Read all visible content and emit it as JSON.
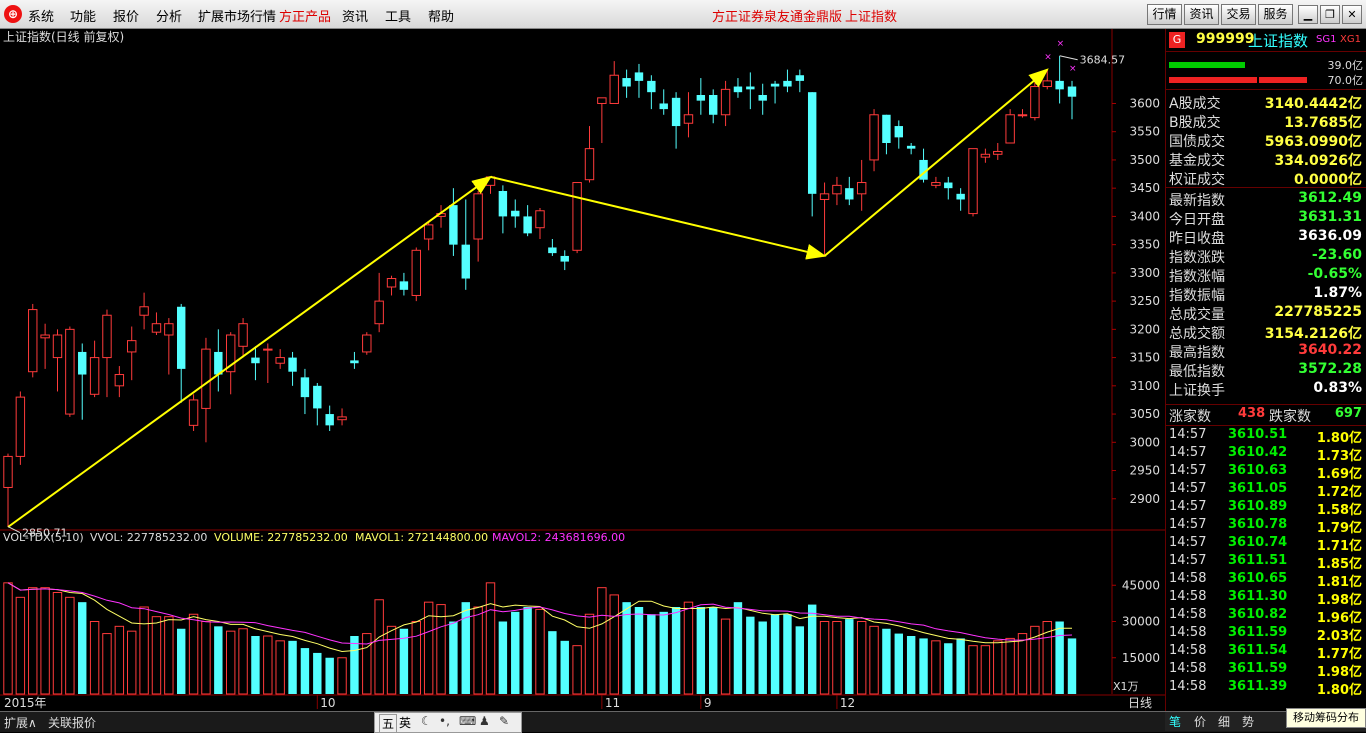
{
  "menubar": {
    "items": [
      "系统",
      "功能",
      "报价",
      "分析",
      "扩展市场行情",
      "方正产品",
      "资讯",
      "工具",
      "帮助"
    ],
    "red_item_index": 5,
    "center_title": "方正证券泉友通金鼎版",
    "center_index_title": "上证指数",
    "right_buttons": [
      "行情",
      "资讯",
      "交易",
      "服务"
    ]
  },
  "chart": {
    "title": "上证指数(日线 前复权)",
    "price_ticks": [
      "3600",
      "3550",
      "3500",
      "3450",
      "3400",
      "3350",
      "3300",
      "3250",
      "3200",
      "3150",
      "3100",
      "3050",
      "3000",
      "2950",
      "2900"
    ],
    "high_label": "3684.57",
    "low_label": "2850.71",
    "vol_legend": {
      "name": "VOL-TDX(5,10)",
      "vvol": "VVOL: 227785232.00",
      "volume": "VOLUME: 227785232.00",
      "mavol1": "MAVOL1: 272144800.00",
      "mavol2": "MAVOL2: 243681696.00"
    },
    "vol_ticks": [
      "45000",
      "30000",
      "15000"
    ],
    "vol_unit": "X1万",
    "x_labels": [
      "2015年",
      "9",
      "10",
      "11",
      "12"
    ],
    "period": "日线",
    "colors": {
      "up": "#ff3b3b",
      "down": "#54ffff",
      "mavol1": "#ffff66",
      "mavol2": "#ff33ff",
      "trend": "#ffff00"
    }
  },
  "chart_data": {
    "type": "candlestick",
    "candles": [
      [
        2920,
        2975,
        2850,
        2980
      ],
      [
        2975,
        3080,
        2960,
        3090
      ],
      [
        3125,
        3235,
        3115,
        3245
      ],
      [
        3185,
        3190,
        3130,
        3210
      ],
      [
        3150,
        3190,
        3090,
        3200
      ],
      [
        3050,
        3200,
        3045,
        3205
      ],
      [
        3160,
        3120,
        3040,
        3175
      ],
      [
        3085,
        3150,
        3080,
        3180
      ],
      [
        3150,
        3225,
        3080,
        3235
      ],
      [
        3100,
        3120,
        3080,
        3135
      ],
      [
        3160,
        3180,
        3110,
        3205
      ],
      [
        3225,
        3240,
        3200,
        3265
      ],
      [
        3195,
        3210,
        3190,
        3230
      ],
      [
        3190,
        3210,
        3120,
        3220
      ],
      [
        3240,
        3130,
        3070,
        3245
      ],
      [
        3030,
        3075,
        3020,
        3085
      ],
      [
        3060,
        3165,
        3000,
        3185
      ],
      [
        3160,
        3120,
        3090,
        3200
      ],
      [
        3125,
        3190,
        3085,
        3195
      ],
      [
        3170,
        3210,
        3150,
        3220
      ],
      [
        3150,
        3140,
        3110,
        3170
      ],
      [
        3165,
        3165,
        3105,
        3175
      ],
      [
        3140,
        3150,
        3130,
        3165
      ],
      [
        3150,
        3125,
        3100,
        3160
      ],
      [
        3115,
        3080,
        3050,
        3130
      ],
      [
        3100,
        3060,
        3030,
        3105
      ],
      [
        3050,
        3030,
        3020,
        3065
      ],
      [
        3040,
        3045,
        3030,
        3060
      ],
      [
        3145,
        3140,
        3130,
        3160
      ],
      [
        3160,
        3190,
        3155,
        3195
      ],
      [
        3210,
        3250,
        3195,
        3300
      ],
      [
        3275,
        3290,
        3260,
        3295
      ],
      [
        3285,
        3270,
        3260,
        3300
      ],
      [
        3260,
        3340,
        3250,
        3345
      ],
      [
        3360,
        3385,
        3340,
        3390
      ],
      [
        3400,
        3405,
        3380,
        3420
      ],
      [
        3420,
        3350,
        3330,
        3450
      ],
      [
        3350,
        3290,
        3270,
        3430
      ],
      [
        3360,
        3440,
        3320,
        3445
      ],
      [
        3455,
        3470,
        3440,
        3470
      ],
      [
        3445,
        3400,
        3370,
        3455
      ],
      [
        3410,
        3400,
        3380,
        3430
      ],
      [
        3400,
        3370,
        3365,
        3420
      ],
      [
        3380,
        3410,
        3360,
        3415
      ],
      [
        3345,
        3335,
        3330,
        3360
      ],
      [
        3330,
        3320,
        3305,
        3340
      ],
      [
        3340,
        3460,
        3335,
        3460
      ],
      [
        3465,
        3520,
        3460,
        3560
      ],
      [
        3600,
        3610,
        3530,
        3610
      ],
      [
        3600,
        3650,
        3600,
        3675
      ],
      [
        3645,
        3630,
        3610,
        3660
      ],
      [
        3655,
        3640,
        3610,
        3670
      ],
      [
        3640,
        3620,
        3590,
        3650
      ],
      [
        3600,
        3590,
        3580,
        3625
      ],
      [
        3610,
        3560,
        3520,
        3620
      ],
      [
        3565,
        3580,
        3540,
        3620
      ],
      [
        3615,
        3605,
        3580,
        3645
      ],
      [
        3615,
        3580,
        3565,
        3625
      ],
      [
        3580,
        3625,
        3560,
        3640
      ],
      [
        3630,
        3620,
        3610,
        3645
      ],
      [
        3630,
        3625,
        3590,
        3655
      ],
      [
        3615,
        3605,
        3580,
        3635
      ],
      [
        3635,
        3630,
        3600,
        3640
      ],
      [
        3640,
        3630,
        3620,
        3660
      ],
      [
        3650,
        3640,
        3620,
        3660
      ],
      [
        3620,
        3440,
        3400,
        3620
      ],
      [
        3430,
        3440,
        3330,
        3460
      ],
      [
        3440,
        3455,
        3420,
        3470
      ],
      [
        3450,
        3430,
        3420,
        3470
      ],
      [
        3440,
        3460,
        3410,
        3500
      ],
      [
        3500,
        3580,
        3480,
        3590
      ],
      [
        3580,
        3530,
        3510,
        3580
      ],
      [
        3560,
        3540,
        3520,
        3570
      ],
      [
        3525,
        3520,
        3510,
        3530
      ],
      [
        3500,
        3465,
        3460,
        3520
      ],
      [
        3455,
        3460,
        3450,
        3470
      ],
      [
        3460,
        3450,
        3430,
        3470
      ],
      [
        3440,
        3430,
        3410,
        3450
      ],
      [
        3405,
        3520,
        3400,
        3520
      ],
      [
        3505,
        3510,
        3495,
        3520
      ],
      [
        3510,
        3515,
        3500,
        3530
      ],
      [
        3530,
        3580,
        3530,
        3590
      ],
      [
        3580,
        3580,
        3575,
        3590
      ],
      [
        3575,
        3630,
        3570,
        3640
      ],
      [
        3630,
        3640,
        3625,
        3660
      ],
      [
        3640,
        3625,
        3600,
        3684
      ],
      [
        3630,
        3612,
        3572,
        3640
      ]
    ],
    "volume": [
      46000,
      40000,
      44000,
      44000,
      42000,
      40000,
      38000,
      30000,
      25000,
      28000,
      26000,
      36000,
      32000,
      32000,
      27000,
      33000,
      30000,
      28000,
      26000,
      27000,
      24000,
      24000,
      22000,
      22000,
      19000,
      17000,
      15000,
      15000,
      24000,
      25000,
      39000,
      28000,
      27000,
      30000,
      38000,
      37000,
      30000,
      38000,
      36000,
      46000,
      30000,
      34000,
      36000,
      35000,
      26000,
      22000,
      20000,
      33000,
      44000,
      41000,
      38000,
      36000,
      33000,
      34000,
      36000,
      38000,
      36000,
      36000,
      31000,
      38000,
      32000,
      30000,
      33000,
      33000,
      28000,
      37000,
      30000,
      30000,
      31000,
      30000,
      28000,
      27000,
      25000,
      24000,
      23000,
      22000,
      21000,
      23000,
      20000,
      20000,
      22000,
      23000,
      25000,
      28000,
      30000,
      30000,
      23000
    ],
    "price_range": [
      2850,
      3700
    ]
  },
  "right_panel": {
    "code": "999999",
    "name": "上证指数",
    "tags": [
      "SG1",
      "XG1"
    ],
    "bar_values": [
      "39.0亿",
      "70.0亿"
    ],
    "turnover": [
      {
        "label": "A股成交",
        "value": "3140.4442亿",
        "color": "#ffff44"
      },
      {
        "label": "B股成交",
        "value": "13.7685亿",
        "color": "#ffff44"
      },
      {
        "label": "国债成交",
        "value": "5963.0990亿",
        "color": "#ffff44"
      },
      {
        "label": "基金成交",
        "value": "334.0926亿",
        "color": "#ffff44"
      },
      {
        "label": "权证成交",
        "value": "0.0000亿",
        "color": "#ffff44"
      }
    ],
    "stats": [
      {
        "label": "最新指数",
        "value": "3612.49",
        "color": "#33ff33"
      },
      {
        "label": "今日开盘",
        "value": "3631.31",
        "color": "#33ff33"
      },
      {
        "label": "昨日收盘",
        "value": "3636.09",
        "color": "#ffffff"
      },
      {
        "label": "指数涨跌",
        "value": "-23.60",
        "color": "#33ff33"
      },
      {
        "label": "指数涨幅",
        "value": "-0.65%",
        "color": "#33ff33"
      },
      {
        "label": "指数振幅",
        "value": "1.87%",
        "color": "#ffffff"
      },
      {
        "label": "总成交量",
        "value": "227785225",
        "color": "#ffff44"
      },
      {
        "label": "总成交额",
        "value": "3154.2126亿",
        "color": "#ffff44"
      },
      {
        "label": "最高指数",
        "value": "3640.22",
        "color": "#ff3b3b"
      },
      {
        "label": "最低指数",
        "value": "3572.28",
        "color": "#33ff33"
      },
      {
        "label": "上证换手",
        "value": "0.83%",
        "color": "#ffffff"
      }
    ],
    "updown": {
      "up_label": "涨家数",
      "up_value": "438",
      "down_label": "跌家数",
      "down_value": "697"
    },
    "ticks": [
      {
        "time": "14:57",
        "price": "3610.51",
        "vol": "1.80亿"
      },
      {
        "time": "14:57",
        "price": "3610.42",
        "vol": "1.73亿"
      },
      {
        "time": "14:57",
        "price": "3610.63",
        "vol": "1.69亿"
      },
      {
        "time": "14:57",
        "price": "3611.05",
        "vol": "1.72亿"
      },
      {
        "time": "14:57",
        "price": "3610.89",
        "vol": "1.58亿"
      },
      {
        "time": "14:57",
        "price": "3610.78",
        "vol": "1.79亿"
      },
      {
        "time": "14:57",
        "price": "3610.74",
        "vol": "1.71亿"
      },
      {
        "time": "14:57",
        "price": "3611.51",
        "vol": "1.85亿"
      },
      {
        "time": "14:58",
        "price": "3610.65",
        "vol": "1.81亿"
      },
      {
        "time": "14:58",
        "price": "3611.30",
        "vol": "1.98亿"
      },
      {
        "time": "14:58",
        "price": "3610.82",
        "vol": "1.96亿"
      },
      {
        "time": "14:58",
        "price": "3611.59",
        "vol": "2.03亿"
      },
      {
        "time": "14:58",
        "price": "3611.54",
        "vol": "1.77亿"
      },
      {
        "time": "14:58",
        "price": "3611.59",
        "vol": "1.98亿"
      },
      {
        "time": "14:58",
        "price": "3611.39",
        "vol": "1.80亿"
      }
    ],
    "tabs": [
      "笔",
      "价",
      "细",
      "势"
    ],
    "popup_button": "移动筹码分布"
  },
  "bottom": {
    "left_tabs": [
      "扩展∧",
      "关联报价"
    ],
    "ime": [
      "五",
      "英"
    ]
  }
}
